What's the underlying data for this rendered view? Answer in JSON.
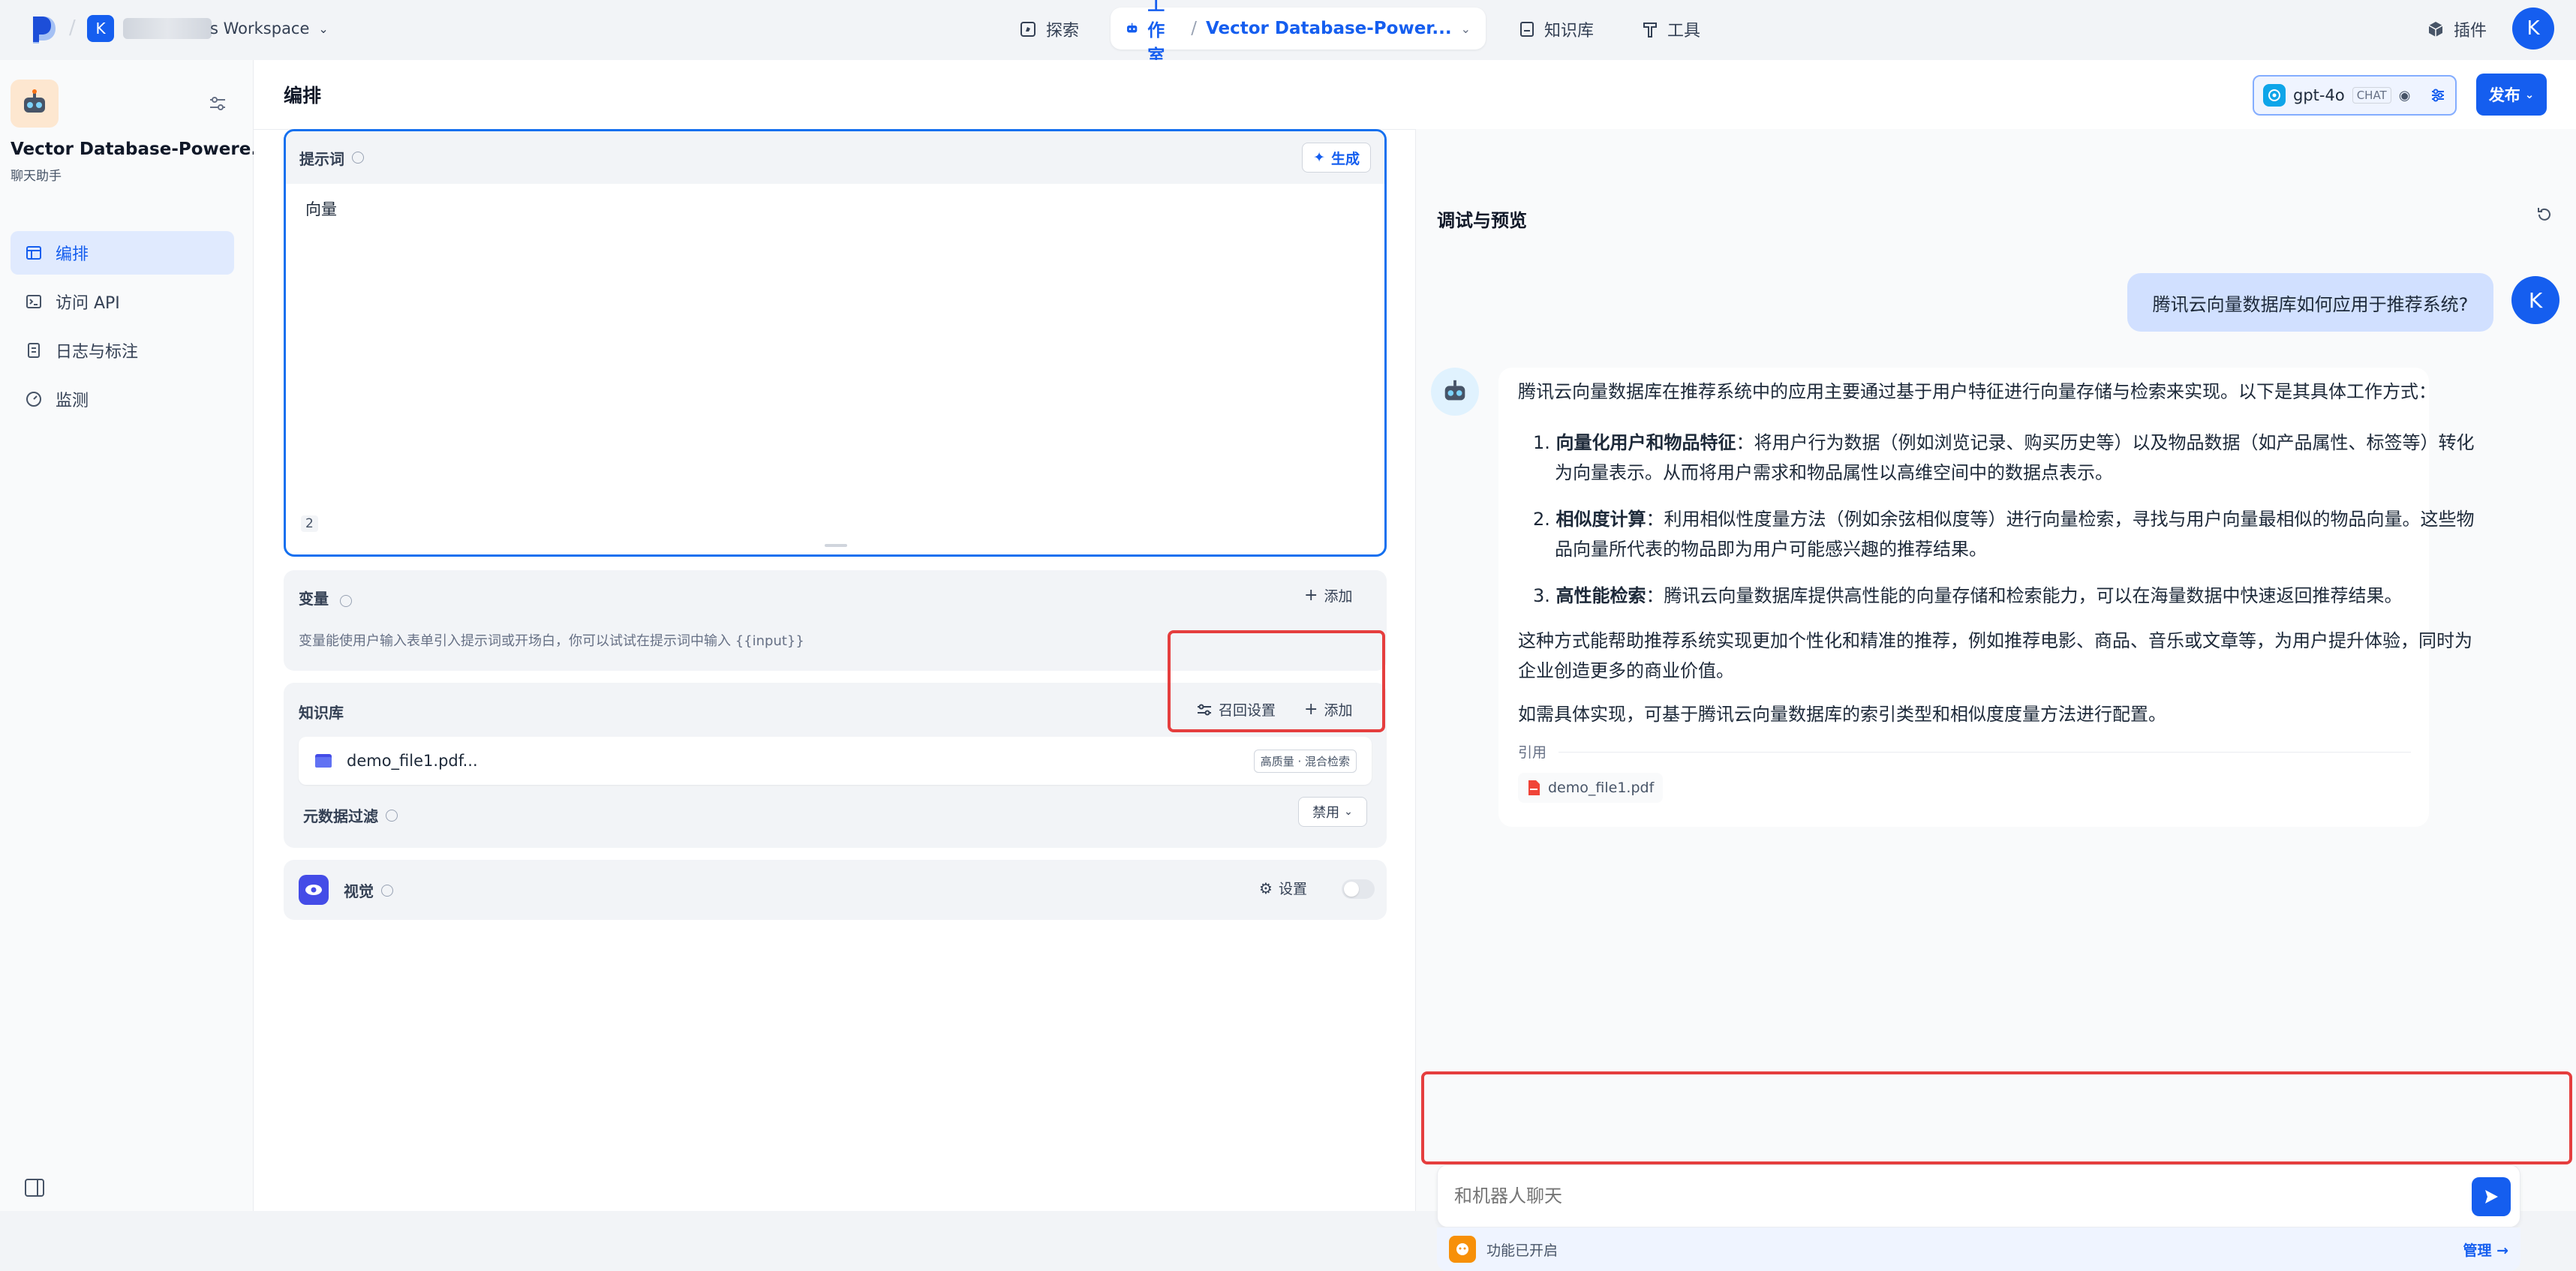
{
  "topnav": {
    "workspace_initial": "K",
    "workspace_name": "s Workspace",
    "explore_label": "探索",
    "studio_label": "工作室",
    "crumb_sep": "/",
    "app_name": "Vector Database-Power...",
    "knowledge_label": "知识库",
    "tools_label": "工具",
    "plugins_label": "插件",
    "avatar_initial": "K"
  },
  "sidebar": {
    "app_title": "Vector Database-Powere...",
    "app_type": "聊天助手",
    "items": [
      {
        "label": "编排",
        "icon": "layout-icon"
      },
      {
        "label": "访问 API",
        "icon": "terminal-icon"
      },
      {
        "label": "日志与标注",
        "icon": "document-icon"
      },
      {
        "label": "监测",
        "icon": "gauge-icon"
      }
    ]
  },
  "editor": {
    "title": "编排",
    "model_name": "gpt-4o",
    "model_badge": "CHAT",
    "publish_label": "发布",
    "prompt_label": "提示词",
    "generate_label": "生成",
    "prompt_text": "向量",
    "prompt_count": "2",
    "variables_label": "变量",
    "add_label": "添加",
    "variables_hint": "变量能使用户输入表单引入提示词或开场白，你可以试试在提示词中输入 {{input}}",
    "knowledge_label": "知识库",
    "recall_label": "召回设置",
    "file_name": "demo_file1.pdf...",
    "file_badge": "高质量 · 混合检索",
    "metadata_label": "元数据过滤",
    "metadata_value": "禁用",
    "vision_label": "视觉",
    "settings_label": "设置"
  },
  "preview": {
    "title": "调试与预览",
    "user_question": "腾讯云向量数据库如何应用于推荐系统?",
    "user_initial": "K",
    "answer_intro": "腾讯云向量数据库在推荐系统中的应用主要通过基于用户特征进行向量存储与检索来实现。以下是其具体工作方式：",
    "answer_items": [
      {
        "num": "1.",
        "bold": "向量化用户和物品特征",
        "line1": "：将用户行为数据（例如浏览记录、购买历史等）以及物品数据（如产品属性、标签等）转化",
        "line2": "为向量表示。从而将用户需求和物品属性以高维空间中的数据点表示。"
      },
      {
        "num": "2.",
        "bold": "相似度计算",
        "line1": "：利用相似性度量方法（例如余弦相似度等）进行向量检索，寻找与用户向量最相似的物品向量。这些物",
        "line2": "品向量所代表的物品即为用户可能感兴趣的推荐结果。"
      },
      {
        "num": "3.",
        "bold": "高性能检索",
        "line1": "：腾讯云向量数据库提供高性能的向量存储和检索能力，可以在海量数据中快速返回推荐结果。",
        "line2": ""
      }
    ],
    "answer_para1_line1": "这种方式能帮助推荐系统实现更加个性化和精准的推荐，例如推荐电影、商品、音乐或文章等，为用户提升体验，同时为",
    "answer_para1_line2": "企业创造更多的商业价值。",
    "answer_para2": "如需具体实现，可基于腾讯云向量数据库的索引类型和相似度度量方法进行配置。",
    "citation_label": "引用",
    "citation_file": "demo_file1.pdf",
    "input_placeholder": "和机器人聊天",
    "feature_status": "功能已开启",
    "manage_label": "管理 →"
  },
  "colors": {
    "accent": "#155eef",
    "highlight_border": "#e53e3e",
    "prompt_border": "#1570ef"
  }
}
